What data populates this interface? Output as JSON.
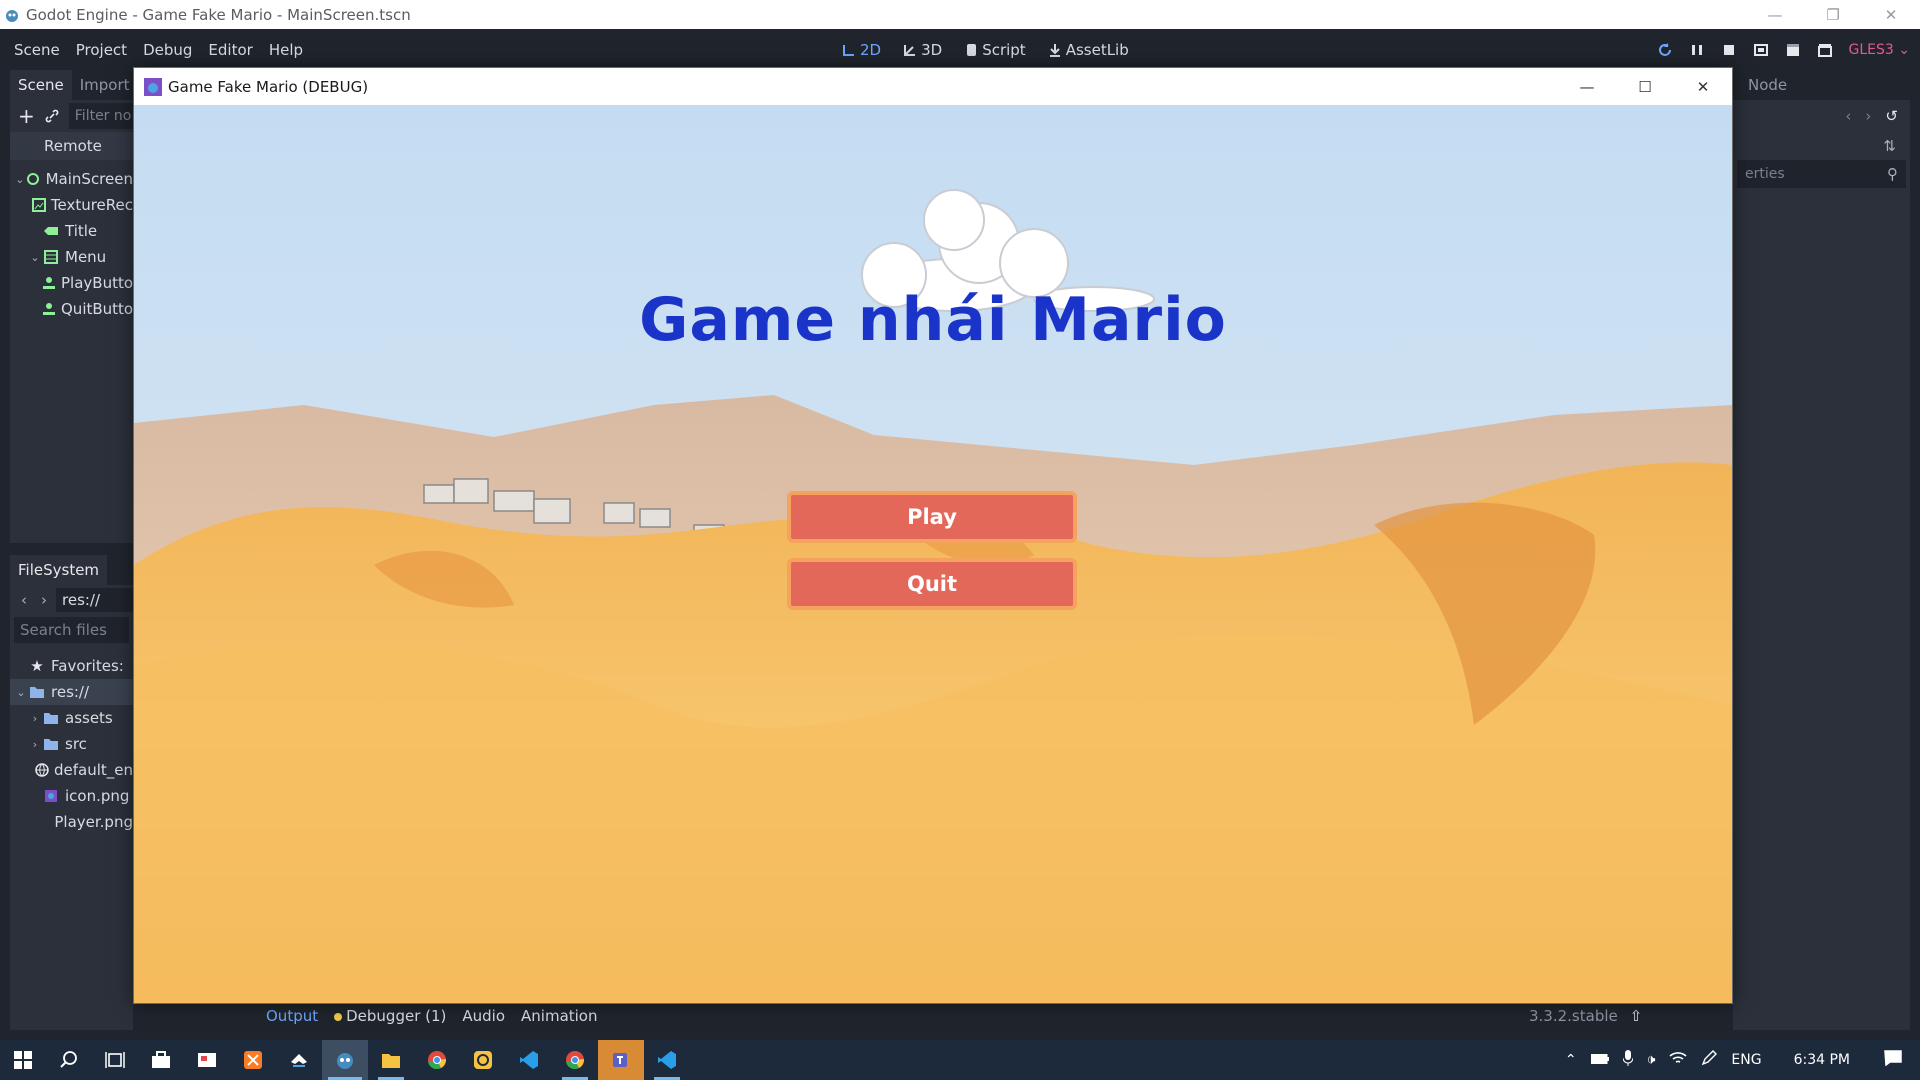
{
  "os_window": {
    "title": "Godot Engine - Game Fake Mario - MainScreen.tscn"
  },
  "menubar": {
    "menus": [
      "Scene",
      "Project",
      "Debug",
      "Editor",
      "Help"
    ],
    "modes": [
      {
        "label": "2D",
        "icon": "2d-icon",
        "active": true
      },
      {
        "label": "3D",
        "icon": "3d-icon",
        "active": false
      },
      {
        "label": "Script",
        "icon": "script-icon",
        "active": false
      },
      {
        "label": "AssetLib",
        "icon": "assetlib-icon",
        "active": false
      }
    ],
    "renderer": "GLES3"
  },
  "scene_dock": {
    "tabs": [
      "Scene",
      "Import"
    ],
    "filter_placeholder": "Filter no",
    "remote_label": "Remote",
    "tree": [
      {
        "label": "MainScreen",
        "depth": 0,
        "expanded": true,
        "icon": "control-icon"
      },
      {
        "label": "TextureRec",
        "depth": 1,
        "icon": "texture-rect-icon"
      },
      {
        "label": "Title",
        "depth": 1,
        "icon": "label-icon"
      },
      {
        "label": "Menu",
        "depth": 1,
        "expanded": true,
        "icon": "vbox-icon"
      },
      {
        "label": "PlayButto",
        "depth": 2,
        "icon": "button-icon"
      },
      {
        "label": "QuitButto",
        "depth": 2,
        "icon": "button-icon"
      }
    ]
  },
  "filesystem_dock": {
    "tab": "FileSystem",
    "path": "res://",
    "search_placeholder": "Search files",
    "items": [
      {
        "label": "Favorites:",
        "icon": "star-icon"
      },
      {
        "label": "res://",
        "icon": "folder-icon",
        "selected": true
      },
      {
        "label": "assets",
        "icon": "folder-icon"
      },
      {
        "label": "src",
        "icon": "folder-icon"
      },
      {
        "label": "default_en",
        "icon": "globe-icon"
      },
      {
        "label": "icon.png",
        "icon": "image-icon"
      },
      {
        "label": "Player.png",
        "icon": "image-icon"
      }
    ]
  },
  "inspector_dock": {
    "tab": "Node",
    "filter_placeholder": "erties"
  },
  "bottom_panel": {
    "tabs": [
      "Output",
      "Debugger (1)",
      "Audio",
      "Animation"
    ],
    "version": "3.3.2.stable"
  },
  "game_window": {
    "title": "Game Fake Mario (DEBUG)",
    "game_title": "Game nhái Mario",
    "play_label": "Play",
    "quit_label": "Quit"
  },
  "taskbar": {
    "language": "ENG",
    "time": "6:34 PM"
  }
}
